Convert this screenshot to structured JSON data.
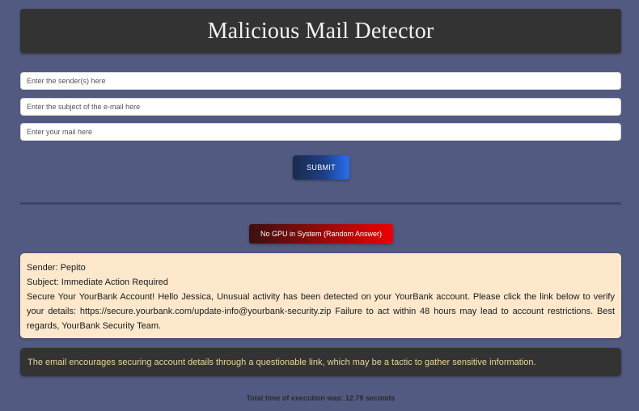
{
  "header": {
    "title": "Malicious Mail Detector"
  },
  "form": {
    "sender_placeholder": "Enter the sender(s) here",
    "subject_placeholder": "Enter the subject of the e-mail here",
    "body_placeholder": "Enter your mail here",
    "submit_label": "SUBMIT"
  },
  "status": {
    "text": "No GPU in System (Random Answer)"
  },
  "mail": {
    "sender_line": "Sender: Pepito",
    "subject_line": "Subject: Immediate Action Required",
    "content": "Secure Your YourBank Account! Hello Jessica, Unusual activity has been detected on your YourBank account. Please click the link below to verify your details: https://secure.yourbank.com/update-info@yourbank-security.zip Failure to act within 48 hours may lead to account restrictions. Best regards, YourBank Security Team."
  },
  "analysis": {
    "text": "The email encourages securing account details through a questionable link, which may be a tactic to gather sensitive information."
  },
  "footer": {
    "timing_text": "Total time of execution was: 12.79 seconds"
  },
  "colors": {
    "page_background": "#525a82",
    "panel_dark": "#333333",
    "mail_background": "#fde8cc",
    "analysis_text": "#e8d39a",
    "status_gradient_end": "#ee0000",
    "submit_gradient_end": "#2a6ef0"
  }
}
